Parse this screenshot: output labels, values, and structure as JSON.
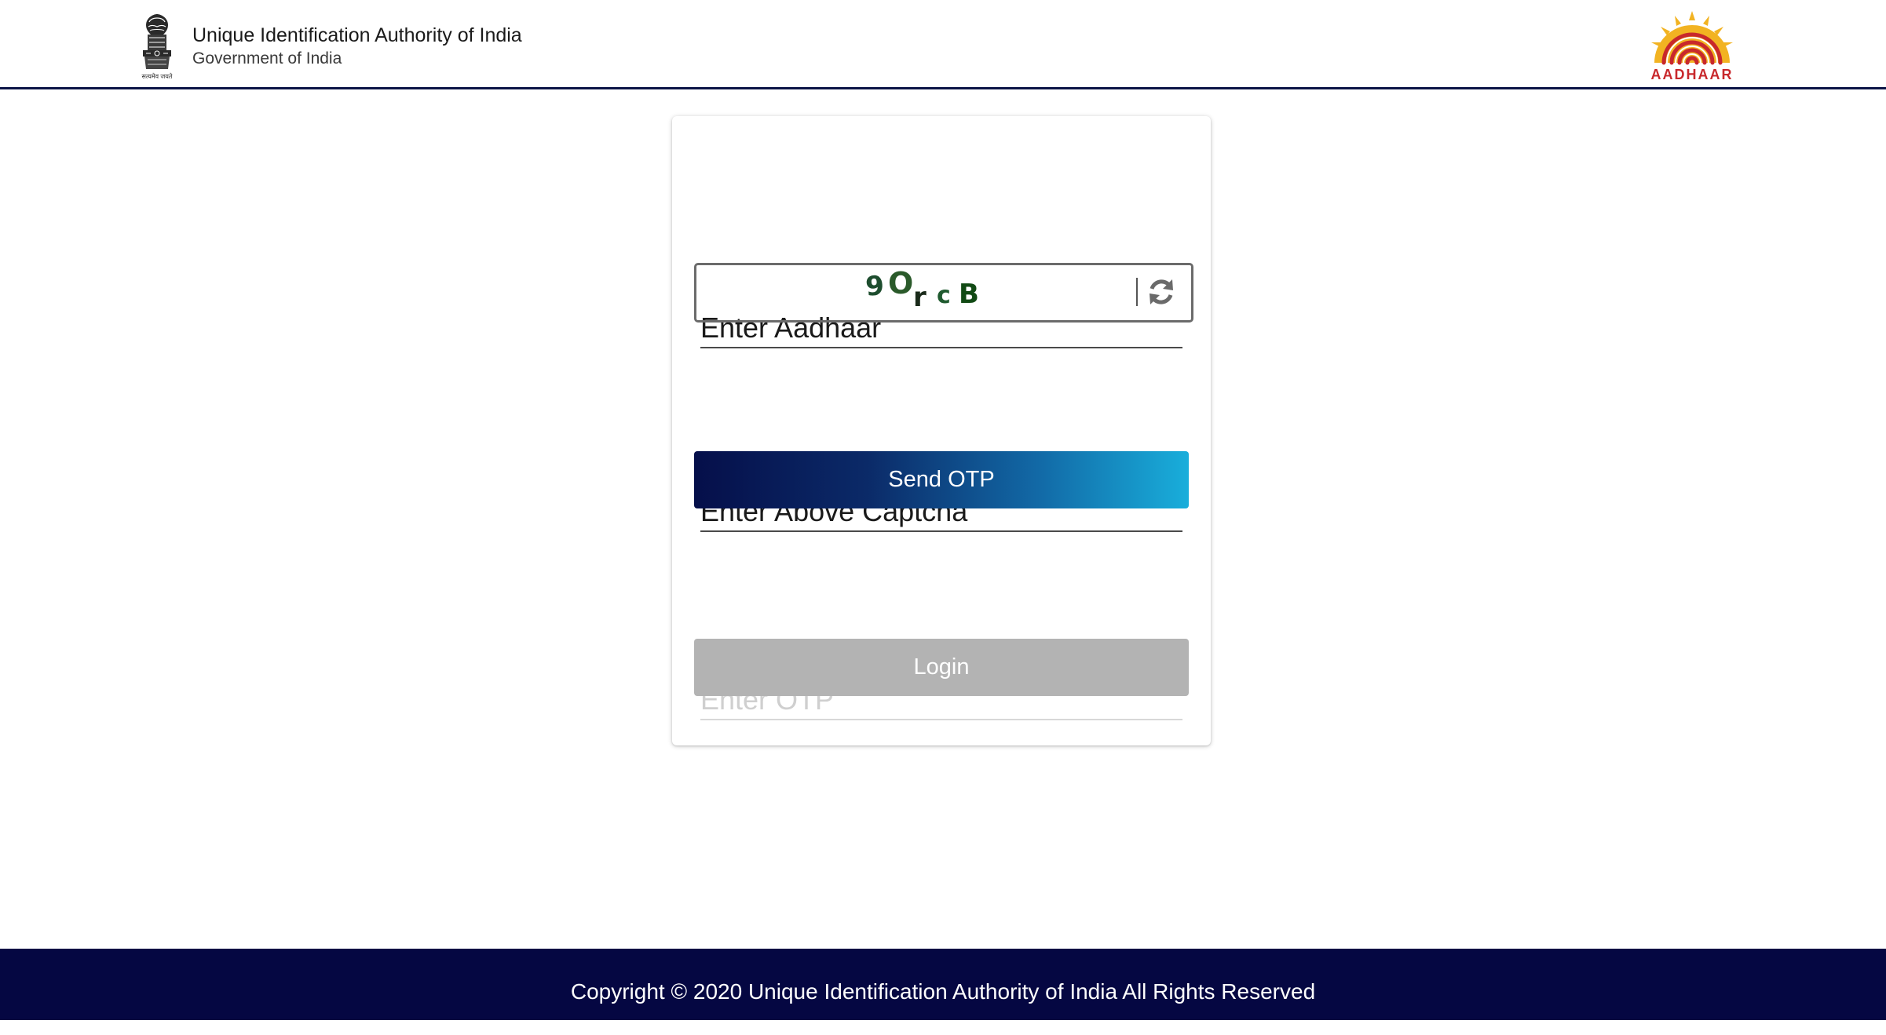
{
  "header": {
    "org_name": "Unique Identification Authority of India",
    "org_sub": "Government of India",
    "emblem_icon": "national-emblem-icon",
    "logo_icon": "aadhaar-logo-icon",
    "logo_text": "AADHAAR",
    "emblem_motto": "सत्यमेव जयते"
  },
  "form": {
    "aadhaar_placeholder": "Enter Aadhaar",
    "captcha_text": "9OrcB",
    "captcha_glyphs": [
      "9",
      "O",
      "r",
      "c",
      "B"
    ],
    "refresh_icon": "refresh-icon",
    "captcha_placeholder": "Enter Above Captcha",
    "send_otp_label": "Send OTP",
    "otp_placeholder": "Enter OTP",
    "login_label": "Login"
  },
  "footer": {
    "copyright": "Copyright © 2020 Unique Identification Authority of India All Rights Reserved"
  },
  "colors": {
    "header_rule": "#0b1446",
    "footer_bg": "#050742",
    "send_gradient_start": "#050f4a",
    "send_gradient_end": "#19aedb",
    "login_disabled": "#b3b3b3",
    "captcha_text": "#1a4a1a",
    "logo_red": "#c8282c",
    "logo_sun": "#f2b322"
  }
}
